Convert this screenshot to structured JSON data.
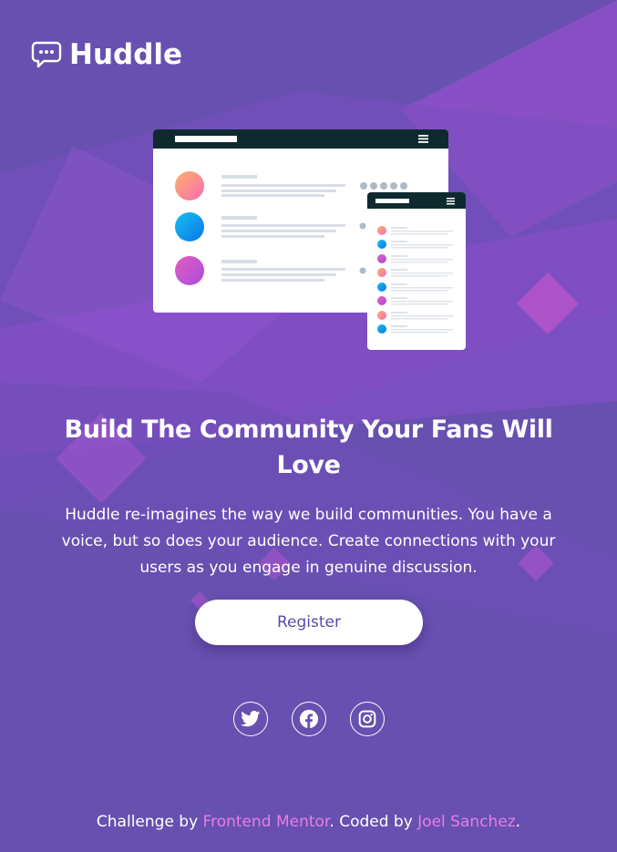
{
  "brand": {
    "name": "Huddle"
  },
  "hero": {
    "title": "Build The Community Your Fans Will Love",
    "description": "Huddle re-imagines the way we build communities. You have a voice, but so does your audience. Create connections with your users as you engage in genuine discussion.",
    "register_label": "Register"
  },
  "socials": [
    {
      "icon": "twitter-icon"
    },
    {
      "icon": "facebook-icon"
    },
    {
      "icon": "instagram-icon"
    }
  ],
  "footer": {
    "prefix": "Challenge by ",
    "link1": "Frontend Mentor",
    "middle": ". Coded by ",
    "link2": "Joel Sanchez",
    "suffix": "."
  },
  "colors": {
    "background": "#6750b0",
    "link": "#e77ee3",
    "button_text": "#5b4aa8",
    "mockup_header": "#0f2a2e"
  }
}
